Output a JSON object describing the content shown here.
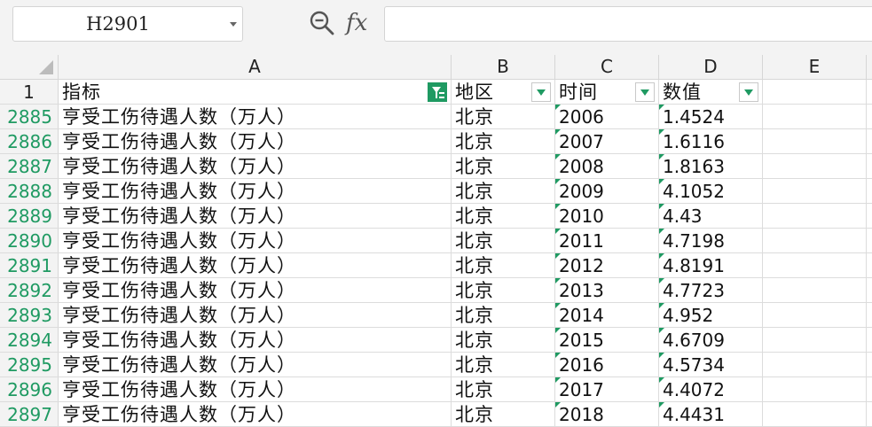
{
  "formula_bar": {
    "cell_ref": "H2901",
    "zoom_icon": "magnifier-minus-icon",
    "fx_label": "fx",
    "formula": ""
  },
  "columns": [
    "A",
    "B",
    "C",
    "D",
    "E"
  ],
  "header_row": {
    "num": "1",
    "cells": [
      "指标",
      "地区",
      "时间",
      "数值",
      ""
    ]
  },
  "rows": [
    {
      "num": "2885",
      "a": "亨受工伤待遇人数（万人）",
      "b": "北京",
      "c": "2006",
      "d": "1.4524"
    },
    {
      "num": "2886",
      "a": "亨受工伤待遇人数（万人）",
      "b": "北京",
      "c": "2007",
      "d": "1.6116"
    },
    {
      "num": "2887",
      "a": "亨受工伤待遇人数（万人）",
      "b": "北京",
      "c": "2008",
      "d": "1.8163"
    },
    {
      "num": "2888",
      "a": "亨受工伤待遇人数（万人）",
      "b": "北京",
      "c": "2009",
      "d": "4.1052"
    },
    {
      "num": "2889",
      "a": "亨受工伤待遇人数（万人）",
      "b": "北京",
      "c": "2010",
      "d": "4.43"
    },
    {
      "num": "2890",
      "a": "亨受工伤待遇人数（万人）",
      "b": "北京",
      "c": "2011",
      "d": "4.7198"
    },
    {
      "num": "2891",
      "a": "亨受工伤待遇人数（万人）",
      "b": "北京",
      "c": "2012",
      "d": "4.8191"
    },
    {
      "num": "2892",
      "a": "亨受工伤待遇人数（万人）",
      "b": "北京",
      "c": "2013",
      "d": "4.7723"
    },
    {
      "num": "2893",
      "a": "亨受工伤待遇人数（万人）",
      "b": "北京",
      "c": "2014",
      "d": "4.952"
    },
    {
      "num": "2894",
      "a": "亨受工伤待遇人数（万人）",
      "b": "北京",
      "c": "2015",
      "d": "4.6709"
    },
    {
      "num": "2895",
      "a": "亨受工伤待遇人数（万人）",
      "b": "北京",
      "c": "2016",
      "d": "4.5734"
    },
    {
      "num": "2896",
      "a": "亨受工伤待遇人数（万人）",
      "b": "北京",
      "c": "2017",
      "d": "4.4072"
    },
    {
      "num": "2897",
      "a": "亨受工伤待遇人数（万人）",
      "b": "北京",
      "c": "2018",
      "d": "4.4431"
    }
  ],
  "colors": {
    "accent": "#1f9a62",
    "gridline": "#dcdcdc",
    "header_bg": "#f3f3f3"
  }
}
